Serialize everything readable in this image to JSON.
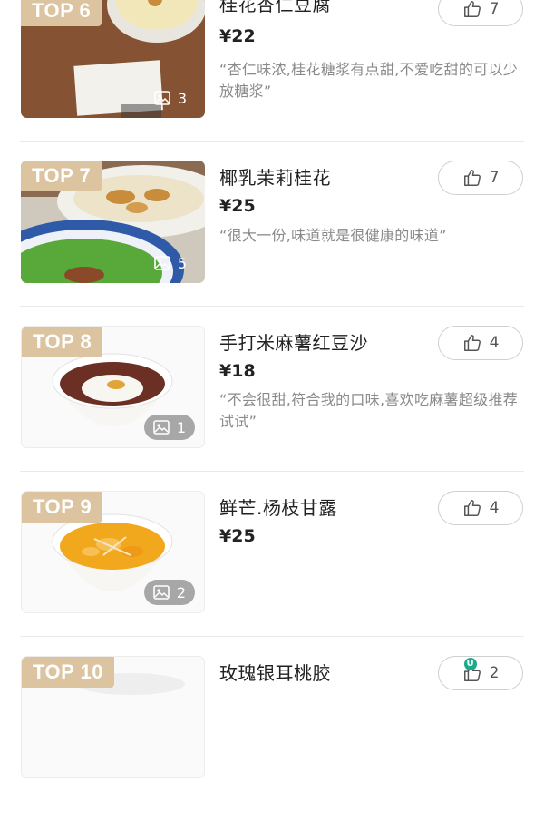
{
  "colors": {
    "rank_badge": "#dcc4a1",
    "quote_text": "#8a8a8a",
    "divider": "#e9e9e9",
    "notify_badge": "#1aab8a"
  },
  "icons": {
    "like": "thumbs-up-icon",
    "photos": "image-icon"
  },
  "items": [
    {
      "rank": "TOP 6",
      "name": "桂花杏仁豆腐",
      "price": "¥22",
      "quote": "“杏仁味浓,桂花糖浆有点甜,不爱吃甜的可以少放糖浆”",
      "likes": "7",
      "photos": "3"
    },
    {
      "rank": "TOP 7",
      "name": "椰乳茉莉桂花",
      "price": "¥25",
      "quote": "“很大一份,味道就是很健康的味道”",
      "likes": "7",
      "photos": "5"
    },
    {
      "rank": "TOP 8",
      "name": "手打米麻薯红豆沙",
      "price": "¥18",
      "quote": "“不会很甜,符合我的口味,喜欢吃麻薯超级推荐试试”",
      "likes": "4",
      "photos": "1"
    },
    {
      "rank": "TOP 9",
      "name": "鲜芒.杨枝甘露",
      "price": "¥25",
      "quote": "",
      "likes": "4",
      "photos": "2"
    },
    {
      "rank": "TOP 10",
      "name": "玫瑰银耳桃胶",
      "price": "",
      "quote": "",
      "likes": "2",
      "photos": "",
      "like_badge": "U"
    }
  ]
}
